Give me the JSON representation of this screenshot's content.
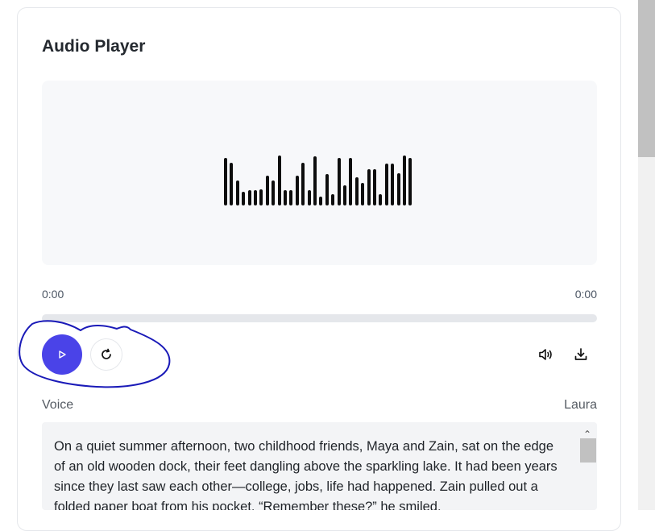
{
  "player": {
    "title": "Audio Player",
    "current_time": "0:00",
    "duration": "0:00",
    "progress": 0,
    "waveform_levels": [
      0.95,
      0.85,
      0.5,
      0.27,
      0.3,
      0.3,
      0.33,
      0.6,
      0.5,
      1.0,
      0.3,
      0.3,
      0.6,
      0.85,
      0.3,
      0.98,
      0.18,
      0.63,
      0.23,
      0.95,
      0.4,
      0.95,
      0.57,
      0.45,
      0.73,
      0.73,
      0.23,
      0.84,
      0.84,
      0.65,
      1.0,
      0.95
    ],
    "accent_color": "#4a43e8"
  },
  "controls": {
    "play_icon": "play-icon",
    "retry_icon": "refresh-icon",
    "volume_icon": "volume-icon",
    "download_icon": "download-icon"
  },
  "voice": {
    "label": "Voice",
    "value": "Laura"
  },
  "text": {
    "content": "On a quiet summer afternoon, two childhood friends, Maya and Zain, sat on the edge of an old wooden dock, their feet dangling above the sparkling lake. It had been years since they last saw each other—college, jobs, life had happened. Zain pulled out a folded paper boat from his pocket. “Remember these?” he smiled."
  }
}
